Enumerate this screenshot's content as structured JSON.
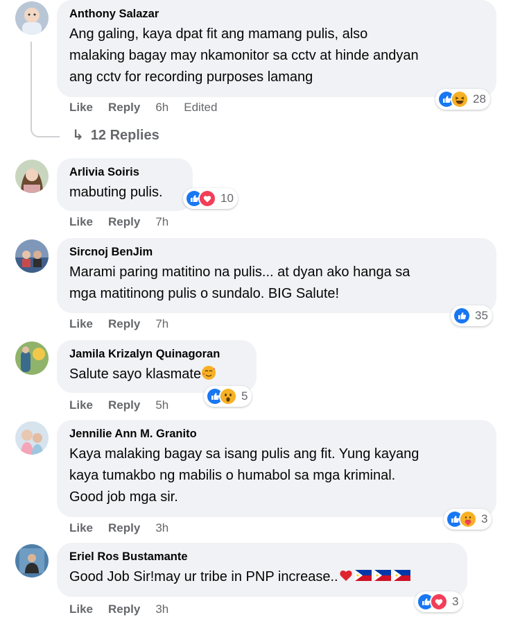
{
  "colors": {
    "bubble": "#f0f2f5",
    "secondary_text": "#65676b",
    "like_blue": "#1877f2",
    "love_red": "#f33e58",
    "haha_yellow": "#f7b125"
  },
  "actions": {
    "like": "Like",
    "reply": "Reply"
  },
  "replies_link": {
    "icon": "reply-arrow-icon",
    "label": "12 Replies"
  },
  "comments": [
    {
      "author": "Anthony Salazar",
      "lines": [
        "Ang galing, kaya dpat fit ang mamang pulis, also",
        "malaking bagay may nkamonitor sa cctv at hinde andyan",
        "ang cctv for recording purposes lamang"
      ],
      "time": "6h",
      "edited": "Edited",
      "reactions": [
        "like",
        "haha"
      ],
      "reaction_count": "28"
    },
    {
      "author": "Arlivia Soiris",
      "lines": [
        "mabuting pulis."
      ],
      "time": "7h",
      "reactions": [
        "like",
        "love"
      ],
      "reaction_count": "10"
    },
    {
      "author": "Sircnoj BenJim",
      "lines": [
        "Marami paring matitino na pulis... at dyan ako hanga sa",
        "mga matitinong pulis o sundalo. BIG Salute!"
      ],
      "time": "7h",
      "reactions": [
        "like"
      ],
      "reaction_count": "35"
    },
    {
      "author": "Jamila Krizalyn Quinagoran",
      "lines": [
        "Salute sayo klasmate"
      ],
      "text_emoji": "smiling-face-with-hearts-emoji",
      "time": "5h",
      "reactions": [
        "like",
        "wow"
      ],
      "reaction_count": "5"
    },
    {
      "author": "Jennilie Ann M. Granito",
      "lines": [
        "Kaya malaking bagay sa isang pulis ang fit. Yung kayang",
        "kaya tumakbo ng mabilis o humabol sa mga kriminal.",
        "Good job mga sir."
      ],
      "time": "3h",
      "reactions": [
        "like",
        "care"
      ],
      "reaction_count": "3"
    },
    {
      "author": "Eriel Ros Bustamante",
      "lines": [
        "Good Job Sir!may ur tribe in PNP increase.."
      ],
      "text_emoji": "heart-and-philippine-flags-emoji",
      "time": "3h",
      "reactions": [
        "like",
        "love"
      ],
      "reaction_count": "3"
    }
  ]
}
